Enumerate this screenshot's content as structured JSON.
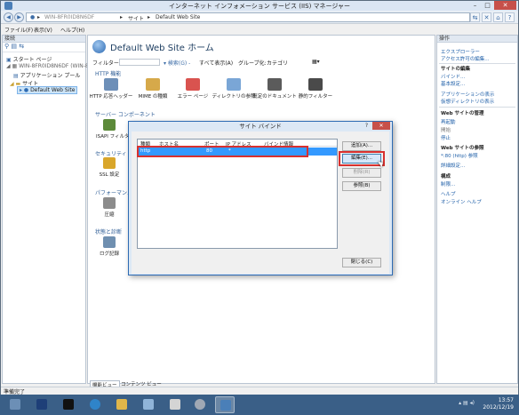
{
  "window": {
    "title": "インターネット インフォメーション サービス (IIS) マネージャー",
    "minimize": "–",
    "maximize": "□",
    "close": "✕"
  },
  "address": {
    "server": "WIN-8FR0ID8N6DF",
    "sep1": "▸",
    "sites": "サイト",
    "sep2": "▸",
    "site": "Default Web Site",
    "sep3": "▸",
    "tools": [
      "⇆",
      "✕",
      "⌂",
      "?"
    ]
  },
  "menu": {
    "file": "ファイル(F)",
    "view": "表示(V)",
    "help": "ヘルプ(H)"
  },
  "connections": {
    "header": "接続",
    "toolbar": "⚲ ▤ ⇆",
    "items": [
      {
        "label": "スタート ページ"
      },
      {
        "label": "WIN-8FR0ID8N6DF (WIN-8..."
      },
      {
        "label": "アプリケーション プール"
      },
      {
        "label": "サイト"
      },
      {
        "label": "Default Web Site"
      }
    ]
  },
  "center": {
    "title": "Default Web Site ホーム",
    "filter_label": "フィルター:",
    "search_label": "▾ 検索(G) -",
    "showall_label": "すべて表示(A)",
    "group_label": "グループ化:",
    "group_value": "カテゴリ",
    "sections": {
      "http": "HTTP 機能",
      "server": "サーバー コンポーネント",
      "security": "セキュリティ",
      "performance": "パフォーマンス",
      "health": "状態と診断"
    },
    "http_features": [
      "HTTP 応答ヘッダー",
      "MIME の種類",
      "エラー ページ",
      "ディレクトリの参照",
      "既定のドキュメント",
      "静的フィルター"
    ],
    "isapi": "ISAPI フィルター",
    "ssl": "SSL 設定",
    "compression": "圧縮",
    "logging": "ログ記録",
    "tab_features": "機能ビュー",
    "tab_content": "コンテンツ ビュー"
  },
  "actions": {
    "header": "操作",
    "explore": "エクスプローラー",
    "edit_permissions": "アクセス許可の編集...",
    "edit_site_header": "サイトの編集",
    "bindings": "バインド...",
    "basic_settings": "基本設定...",
    "view_applications": "アプリケーションの表示",
    "view_vdirs": "仮想ディレクトリの表示",
    "manage_header": "Web サイトの管理",
    "restart": "再起動",
    "start": "開始",
    "stop": "停止",
    "browse_header": "Web サイトの参照",
    "browse_http": "*:80 (http) 参照",
    "advanced": "詳細設定...",
    "config_header": "構成",
    "limits": "制限...",
    "help": "ヘルプ",
    "online_help": "オンライン ヘルプ"
  },
  "status": "準備完了",
  "dialog": {
    "title": "サイト バインド",
    "help": "?",
    "close": "✕",
    "columns": [
      "種類",
      "ホスト名",
      "ポート",
      "IP アドレス",
      "バインド情報"
    ],
    "rows": [
      {
        "type": "http",
        "host": "",
        "port": "80",
        "ip": "*",
        "info": ""
      }
    ],
    "buttons": {
      "add": "追加(A)...",
      "edit": "編集(E)...",
      "remove": "削除(R)",
      "browse": "参照(B)",
      "close": "閉じる(C)"
    }
  },
  "taskbar": {
    "time": "13:57",
    "date": "2012/12/19"
  },
  "colors": {
    "accent": "#2e6bb3",
    "selection": "#3399ff",
    "highlight_box": "#d8302e",
    "taskbar": "#3a5f87"
  }
}
